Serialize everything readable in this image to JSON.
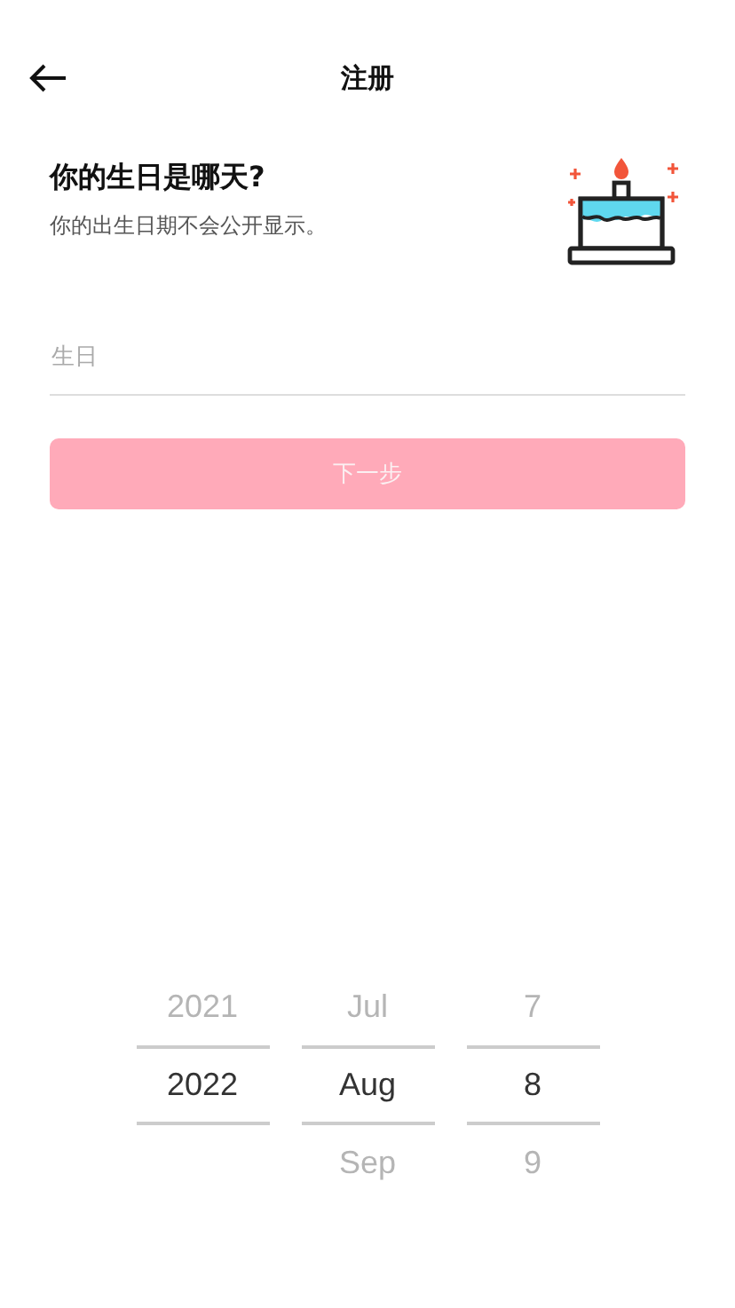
{
  "header": {
    "title": "注册"
  },
  "intro": {
    "heading": "你的生日是哪天?",
    "note": "你的出生日期不会公开显示。"
  },
  "birthday_field": {
    "placeholder": "生日"
  },
  "next_button": {
    "label": "下一步",
    "disabled": true
  },
  "date_picker": {
    "columns": [
      {
        "items": [
          {
            "label": "2021",
            "selected": false
          },
          {
            "label": "2022",
            "selected": true
          }
        ]
      },
      {
        "items": [
          {
            "label": "Jul",
            "selected": false
          },
          {
            "label": "Aug",
            "selected": true
          },
          {
            "label": "Sep",
            "selected": false
          }
        ]
      },
      {
        "items": [
          {
            "label": "7",
            "selected": false
          },
          {
            "label": "8",
            "selected": true
          },
          {
            "label": "9",
            "selected": false
          }
        ]
      }
    ]
  }
}
